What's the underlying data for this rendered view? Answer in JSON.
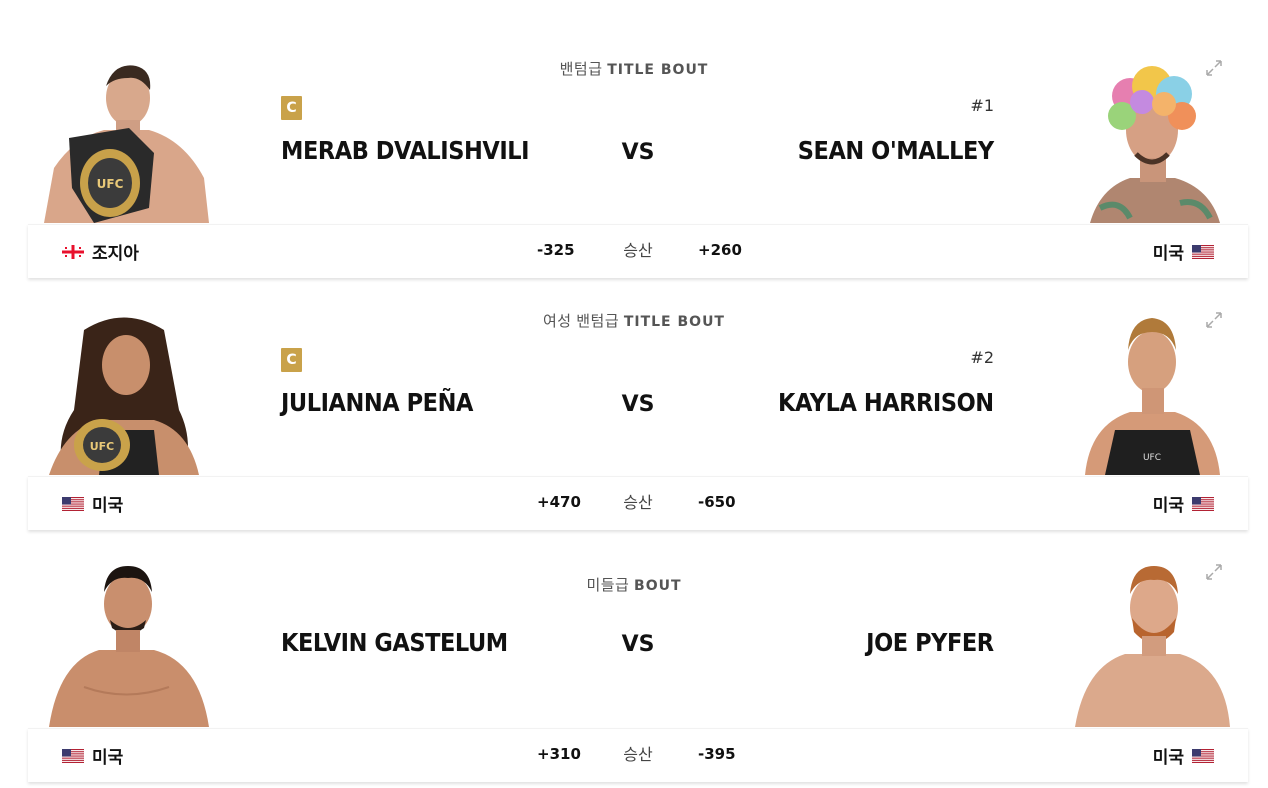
{
  "bouts": [
    {
      "weight_class": "밴텀급",
      "bout_type": "TITLE BOUT",
      "vs_label": "VS",
      "win_label": "승산",
      "left": {
        "name": "MERAB DVALISHVILI",
        "champion_badge": "C",
        "country": "조지아",
        "flag": "georgia-flag",
        "odds": "-325"
      },
      "right": {
        "name": "SEAN O'MALLEY",
        "rank": "#1",
        "country": "미국",
        "flag": "usa-flag",
        "odds": "+260"
      }
    },
    {
      "weight_class": "여성 밴텀급",
      "bout_type": "TITLE BOUT",
      "vs_label": "VS",
      "win_label": "승산",
      "left": {
        "name": "JULIANNA PEÑA",
        "champion_badge": "C",
        "country": "미국",
        "flag": "usa-flag",
        "odds": "+470"
      },
      "right": {
        "name": "KAYLA HARRISON",
        "rank": "#2",
        "country": "미국",
        "flag": "usa-flag",
        "odds": "-650"
      }
    },
    {
      "weight_class": "미들급",
      "bout_type": "BOUT",
      "vs_label": "VS",
      "win_label": "승산",
      "left": {
        "name": "KELVIN GASTELUM",
        "country": "미국",
        "flag": "usa-flag",
        "odds": "+310"
      },
      "right": {
        "name": "JOE PYFER",
        "country": "미국",
        "flag": "usa-flag",
        "odds": "-395"
      }
    }
  ],
  "colors": {
    "champion_badge": "#c9a24a",
    "text": "#111111",
    "muted": "#555555"
  },
  "icons": {
    "expand": "expand-arrows-icon"
  }
}
